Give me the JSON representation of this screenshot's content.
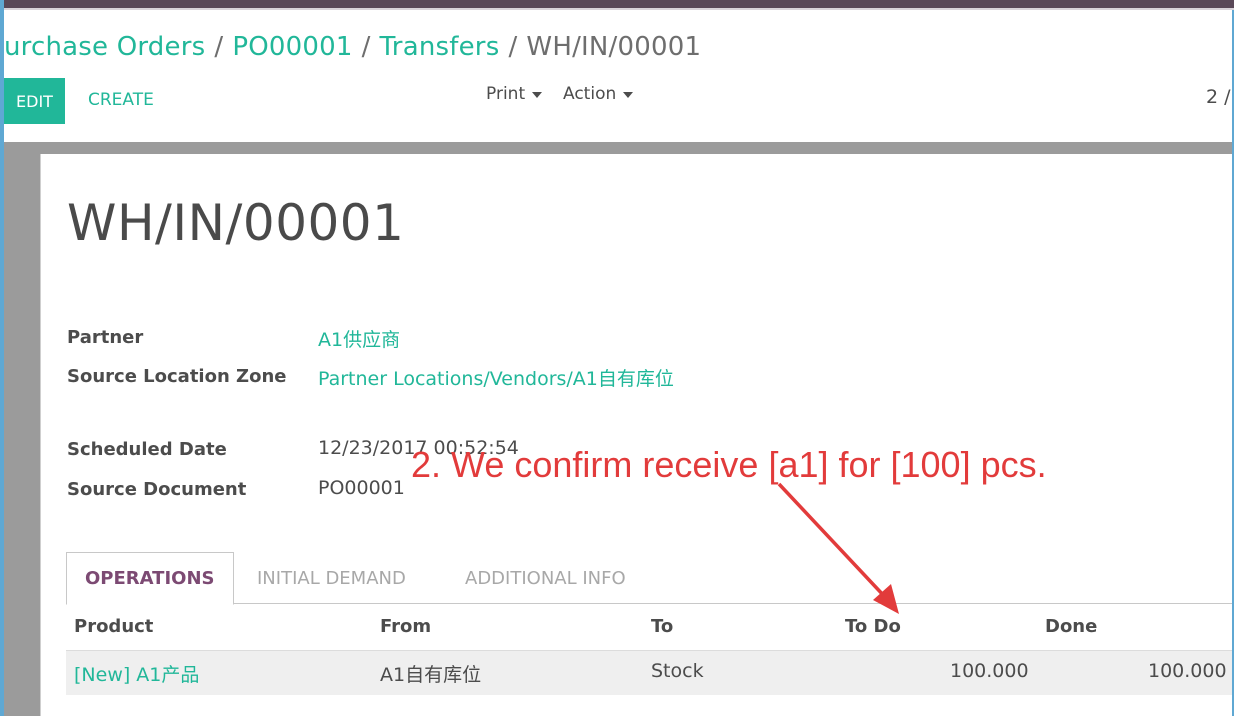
{
  "breadcrumb": {
    "items": [
      "urchase Orders",
      "PO00001",
      "Transfers"
    ],
    "separator": "/",
    "current": "WH/IN/00001"
  },
  "toolbar": {
    "edit_label": "EDIT",
    "create_label": "CREATE",
    "print_label": "Print",
    "action_label": "Action",
    "pager": "2 /"
  },
  "record": {
    "title": "WH/IN/00001",
    "fields": {
      "partner": {
        "label": "Partner",
        "value": "A1供应商"
      },
      "source_location_zone": {
        "label": "Source Location Zone",
        "value": "Partner Locations/Vendors/A1自有库位"
      },
      "scheduled_date": {
        "label": "Scheduled Date",
        "value": "12/23/2017 00:52:54"
      },
      "source_document": {
        "label": "Source Document",
        "value": "PO00001"
      }
    }
  },
  "annotation": {
    "text": "2. We confirm receive [a1] for [100] pcs.",
    "color": "#e23b3b"
  },
  "tabs": [
    {
      "label": "OPERATIONS",
      "active": true
    },
    {
      "label": "INITIAL DEMAND",
      "active": false
    },
    {
      "label": "ADDITIONAL INFO",
      "active": false
    }
  ],
  "table": {
    "columns": [
      "Product",
      "From",
      "To",
      "To Do",
      "Done"
    ],
    "rows": [
      {
        "product": "[New] A1产品",
        "from": "A1自有库位",
        "to": "Stock",
        "to_do": "100.000",
        "done": "100.000"
      }
    ]
  },
  "colors": {
    "accent": "#21b799",
    "brand_bar": "#5a4858",
    "active_tab": "#7c4a73",
    "background_gray": "#9b9b9b"
  }
}
